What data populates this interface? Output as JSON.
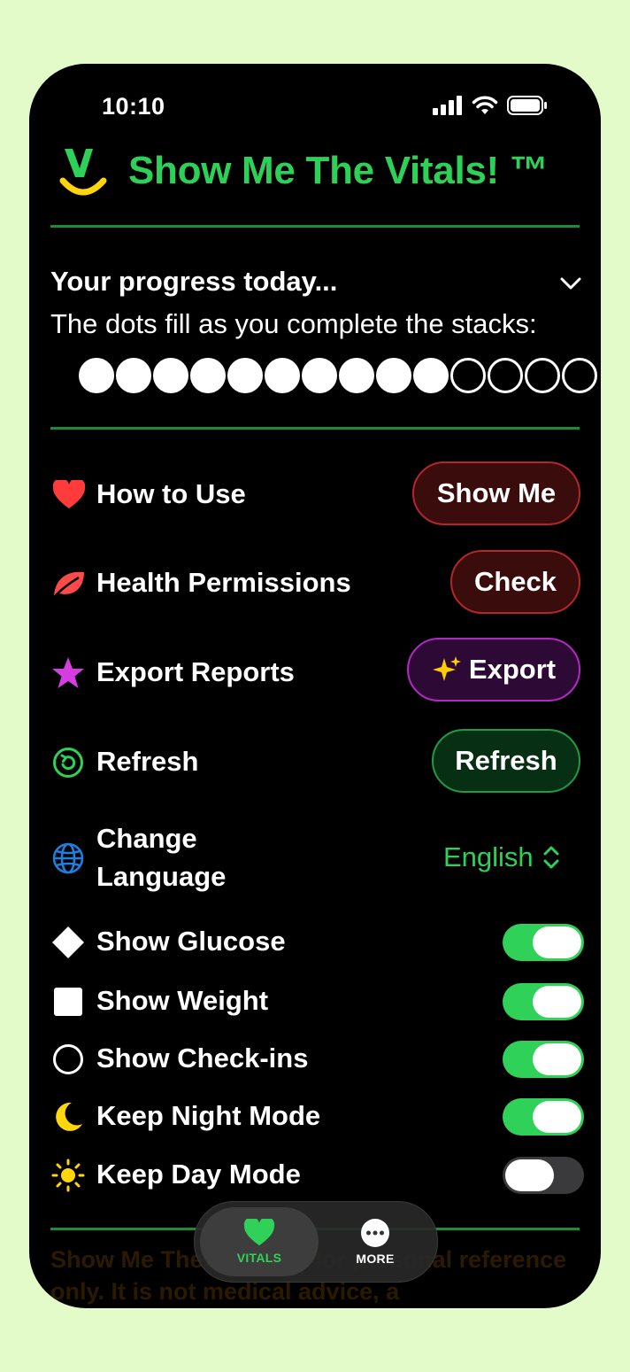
{
  "status_bar": {
    "time": "10:10"
  },
  "header": {
    "title": "Show Me The Vitals! ™"
  },
  "progress": {
    "heading": "Your progress today...",
    "subtitle": "The dots fill as you complete the stacks:",
    "filled": 10,
    "total": 14
  },
  "rows": {
    "how_to_use": {
      "label": "How to Use",
      "button": "Show Me"
    },
    "health_permissions": {
      "label": "Health Permissions",
      "button": "Check"
    },
    "export_reports": {
      "label": "Export Reports",
      "button": "Export",
      "button_icon": "sparkles-icon"
    },
    "refresh": {
      "label": "Refresh",
      "button": "Refresh"
    },
    "change_language": {
      "label_line1": "Change",
      "label_line2": "Language",
      "value": "English"
    }
  },
  "toggles": {
    "show_glucose": {
      "label": "Show Glucose",
      "on": true
    },
    "show_weight": {
      "label": "Show Weight",
      "on": true
    },
    "show_checkins": {
      "label": "Show Check-ins",
      "on": true
    },
    "keep_night_mode": {
      "label": "Keep Night Mode",
      "on": true
    },
    "keep_day_mode": {
      "label": "Keep Day Mode",
      "on": false
    }
  },
  "disclaimer": "Show Me The Vitals! is for personal reference only. It is not medical advice, a",
  "tabbar": {
    "vitals": "VITALS",
    "more": "MORE"
  },
  "colors": {
    "background": "#e2fbc9",
    "accent_green": "#2ed158",
    "toggle_on": "#30d158",
    "red_button_border": "#b3262b",
    "purple_button_border": "#b327c5",
    "heart": "#ff3b3b",
    "star": "#d63de0",
    "globe": "#1e7fe0",
    "moon": "#ffd60a"
  }
}
